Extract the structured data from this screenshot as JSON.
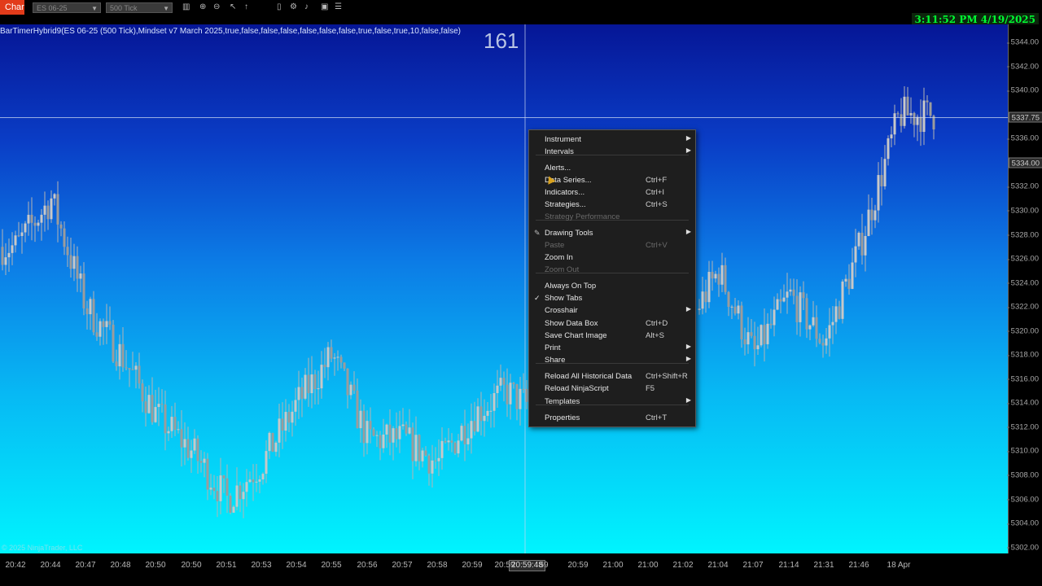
{
  "toolbar": {
    "tab_label": "Chart",
    "instrument": "ES 06-25",
    "interval": "500 Tick",
    "clock": "3:11:52 PM 4/19/2025"
  },
  "chart": {
    "indicator_label": "BarTimerHybrid9(ES 06-25 (500 Tick),Mindset v7 March 2025,true,false,false,false,false,false,false,true,false,true,10,false,false)",
    "bar_count": "161",
    "copyright": "© 2025 NinjaTrader, LLC",
    "price_flags": [
      "5337.75",
      "5334.00"
    ],
    "time_flag": "20:59:48",
    "y_ticks": [
      "5344.00",
      "5342.00",
      "5340.00",
      "5336.00",
      "5332.00",
      "5330.00",
      "5328.00",
      "5326.00",
      "5324.00",
      "5322.00",
      "5320.00",
      "5318.00",
      "5316.00",
      "5314.00",
      "5312.00",
      "5310.00",
      "5308.00",
      "5306.00",
      "5304.00",
      "5302.00"
    ],
    "x_ticks": [
      "20:42",
      "20:44",
      "20:47",
      "20:48",
      "20:50",
      "20:50",
      "20:51",
      "20:53",
      "20:54",
      "20:55",
      "20:56",
      "20:57",
      "20:58",
      "20:59",
      "20:59",
      "59",
      "20:59",
      "21:00",
      "21:00",
      "21:02",
      "21:04",
      "21:07",
      "21:14",
      "21:31",
      "21:46",
      "18 Apr"
    ]
  },
  "chart_data": {
    "type": "candlestick",
    "ylim": [
      5301.5,
      5345.5
    ],
    "x_label_times": [
      "20:42",
      "20:44",
      "20:47",
      "20:48",
      "20:50",
      "20:50",
      "20:51",
      "20:53",
      "20:54",
      "20:55",
      "20:56",
      "20:57",
      "20:58",
      "20:59",
      "20:59",
      "59",
      "20:59",
      "21:00",
      "21:00",
      "21:02",
      "21:04",
      "21:07",
      "21:14",
      "21:31",
      "21:46",
      "18 Apr"
    ],
    "price_path": [
      {
        "label": "20:42",
        "price": 5327.0
      },
      {
        "label": "20:44",
        "price": 5331.0
      },
      {
        "label": "20:47",
        "price": 5322.0
      },
      {
        "label": "20:48",
        "price": 5318.0
      },
      {
        "label": "20:50",
        "price": 5313.0
      },
      {
        "label": "20:50",
        "price": 5310.0
      },
      {
        "label": "20:51",
        "price": 5306.0
      },
      {
        "label": "20:53",
        "price": 5309.0
      },
      {
        "label": "20:54",
        "price": 5314.0
      },
      {
        "label": "20:55",
        "price": 5318.0
      },
      {
        "label": "20:56",
        "price": 5311.0
      },
      {
        "label": "20:57",
        "price": 5311.0
      },
      {
        "label": "20:58",
        "price": 5309.0
      },
      {
        "label": "20:59",
        "price": 5313.0
      },
      {
        "label": "20:59",
        "price": 5315.0
      },
      {
        "label": "59",
        "price": 5313.0
      },
      {
        "label": "20:59",
        "price": 5312.0
      },
      {
        "label": "21:00",
        "price": 5311.0
      },
      {
        "label": "21:00",
        "price": 5313.0
      },
      {
        "label": "21:02",
        "price": 5320.0
      },
      {
        "label": "21:04",
        "price": 5325.0
      },
      {
        "label": "21:07",
        "price": 5318.0
      },
      {
        "label": "21:14",
        "price": 5323.0
      },
      {
        "label": "21:31",
        "price": 5319.0
      },
      {
        "label": "21:46",
        "price": 5327.0
      },
      {
        "label": "18 Apr",
        "price": 5338.0
      }
    ],
    "crosshair_price": 5337.75,
    "last_price": 5334.0
  },
  "menu": {
    "items": [
      {
        "label": "Instrument",
        "shortcut": "",
        "submenu": true
      },
      {
        "label": "Intervals",
        "shortcut": "",
        "submenu": true
      },
      {
        "label": "Alerts...",
        "shortcut": ""
      },
      {
        "label": "Data Series...",
        "shortcut": "Ctrl+F"
      },
      {
        "label": "Indicators...",
        "shortcut": "Ctrl+I"
      },
      {
        "label": "Strategies...",
        "shortcut": "Ctrl+S"
      },
      {
        "label": "Strategy Performance",
        "shortcut": "",
        "disabled": true
      },
      {
        "label": "Drawing Tools",
        "shortcut": "",
        "submenu": true
      },
      {
        "label": "Paste",
        "shortcut": "Ctrl+V",
        "disabled": true
      },
      {
        "label": "Zoom In",
        "shortcut": ""
      },
      {
        "label": "Zoom Out",
        "shortcut": "",
        "disabled": true
      },
      {
        "label": "Always On Top",
        "shortcut": ""
      },
      {
        "label": "Show Tabs",
        "shortcut": "",
        "checked": true
      },
      {
        "label": "Crosshair",
        "shortcut": "",
        "submenu": true
      },
      {
        "label": "Show Data Box",
        "shortcut": "Ctrl+D"
      },
      {
        "label": "Save Chart Image",
        "shortcut": "Alt+S"
      },
      {
        "label": "Print",
        "shortcut": "",
        "submenu": true
      },
      {
        "label": "Share",
        "shortcut": "",
        "submenu": true
      },
      {
        "label": "Reload All Historical Data",
        "shortcut": "Ctrl+Shift+R"
      },
      {
        "label": "Reload NinjaScript",
        "shortcut": "F5"
      },
      {
        "label": "Templates",
        "shortcut": "",
        "submenu": true
      },
      {
        "label": "Properties",
        "shortcut": "Ctrl+T"
      }
    ]
  },
  "icons": {
    "submenu": "chevron-right-icon",
    "check": "check-icon",
    "drawing": "pencil-icon"
  },
  "colors": {
    "chart_top": "#061696",
    "chart_bottom": "#00f4fe",
    "candle": "#b4b4b4",
    "clock_text": "#00ff33",
    "tab_accent": "#e23b1a"
  }
}
